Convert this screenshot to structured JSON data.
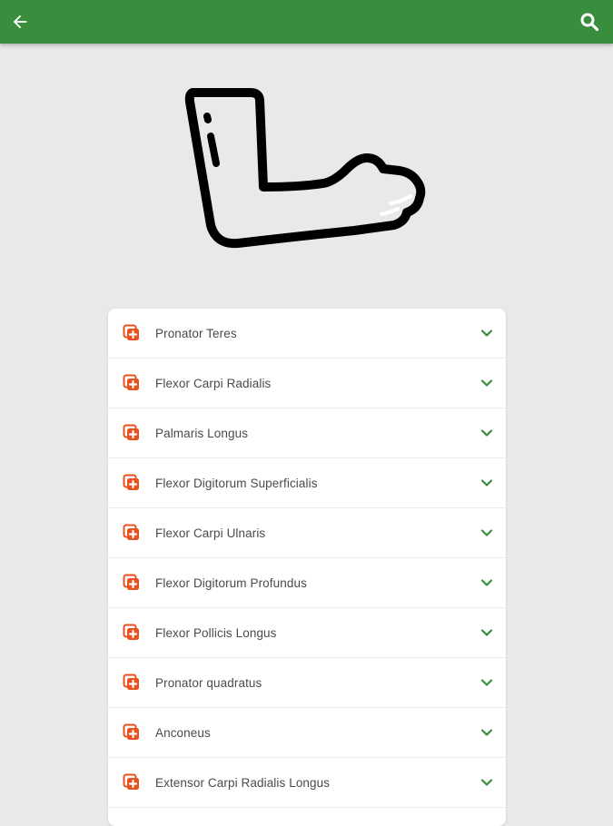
{
  "theme": {
    "app_bar_color": "#388e3c",
    "accent_icon_color": "#e8501e",
    "chevron_color": "#388e3c"
  },
  "app_bar": {
    "back_icon": "arrow-left-icon",
    "search_icon": "search-icon"
  },
  "hero": {
    "icon": "forearm-icon"
  },
  "muscles": {
    "item_icon": "muscle-card-icon",
    "expand_icon": "chevron-down-icon",
    "items": [
      {
        "label": "Pronator Teres"
      },
      {
        "label": "Flexor Carpi Radialis"
      },
      {
        "label": "Palmaris Longus"
      },
      {
        "label": "Flexor Digitorum Superficialis"
      },
      {
        "label": "Flexor Carpi Ulnaris"
      },
      {
        "label": "Flexor Digitorum Profundus"
      },
      {
        "label": "Flexor Pollicis Longus"
      },
      {
        "label": "Pronator quadratus"
      },
      {
        "label": "Anconeus"
      },
      {
        "label": "Extensor Carpi Radialis Longus"
      }
    ]
  }
}
